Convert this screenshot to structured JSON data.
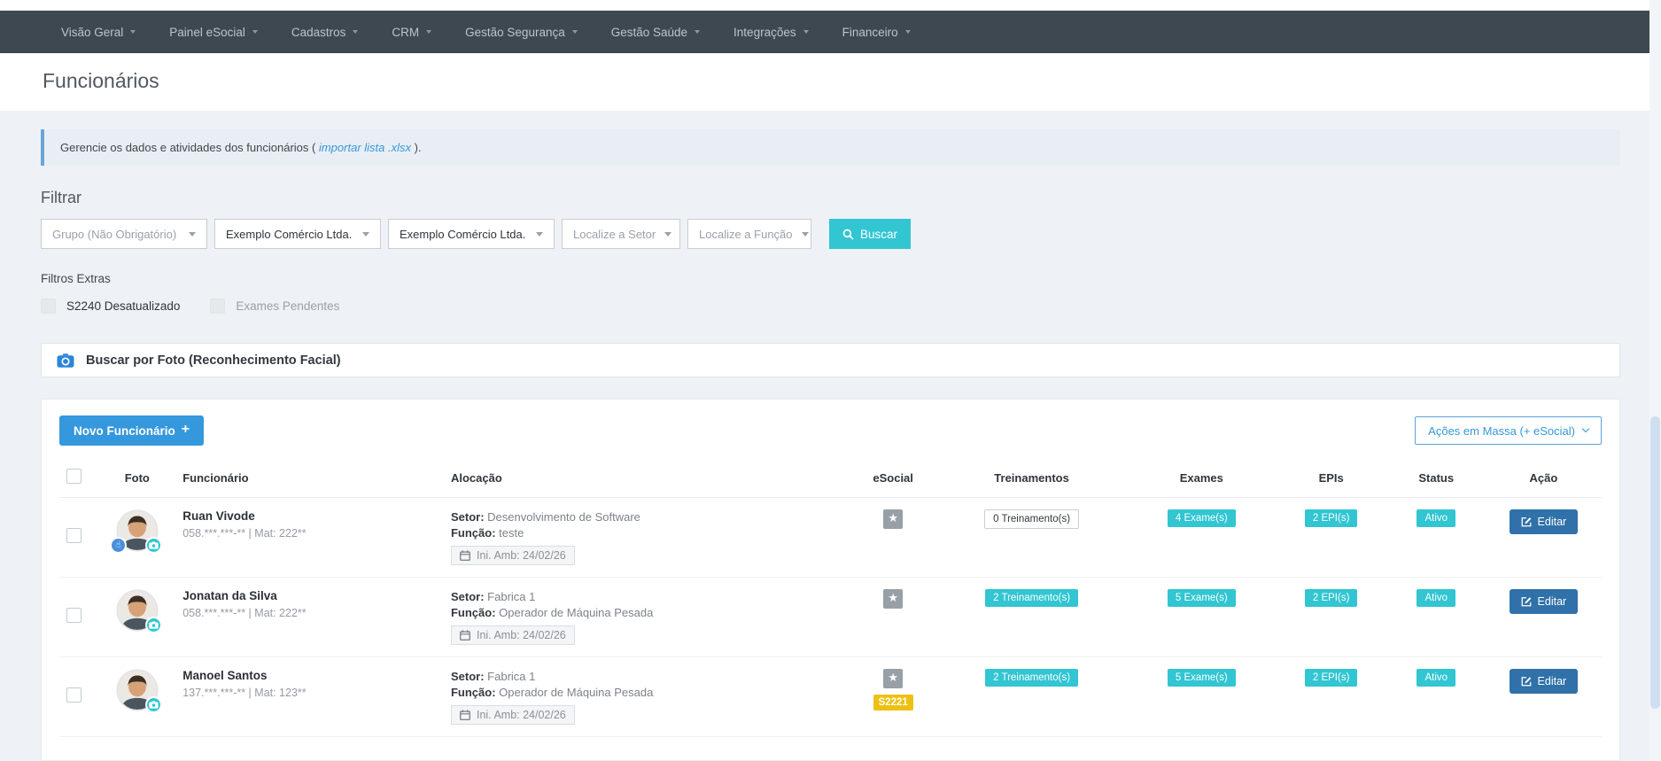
{
  "nav": {
    "items": [
      {
        "label": "Visão Geral"
      },
      {
        "label": "Painel eSocial"
      },
      {
        "label": "Cadastros"
      },
      {
        "label": "CRM"
      },
      {
        "label": "Gestão Segurança"
      },
      {
        "label": "Gestão Saúde"
      },
      {
        "label": "Integrações"
      },
      {
        "label": "Financeiro"
      }
    ]
  },
  "page": {
    "title": "Funcionários"
  },
  "banner": {
    "text_before": "Gerencie os dados e atividades dos funcionários (",
    "link_text": "importar lista .xlsx",
    "text_after": ")."
  },
  "filters": {
    "title": "Filtrar",
    "dropdowns": [
      {
        "label": "Grupo (Não Obrigatório)"
      },
      {
        "label": "Exemplo Comércio Ltda."
      },
      {
        "label": "Exemplo Comércio Ltda."
      },
      {
        "label": "Localize a Setor"
      },
      {
        "label": "Localize a Função"
      }
    ],
    "search_label": "Buscar",
    "extras_title": "Filtros Extras",
    "extras": [
      {
        "label": "S2240 Desatualizado"
      },
      {
        "label": "Exames Pendentes"
      }
    ]
  },
  "photo_search": {
    "label": "Buscar por Foto (Reconhecimento Facial)"
  },
  "toolbar": {
    "new_label": "Novo Funcionário",
    "bulk_label": "Ações em Massa (+ eSocial)"
  },
  "table": {
    "columns": [
      "Foto",
      "Funcionário",
      "Alocação",
      "eSocial",
      "Treinamentos",
      "Exames",
      "EPIs",
      "Status",
      "Ação"
    ],
    "labels": {
      "setor": "Setor:",
      "funcao": "Função:"
    },
    "edit_label": "Editar",
    "rows": [
      {
        "name": "Ruan Vivode",
        "meta": "058.***.***-** | Mat: 222**",
        "setor": "Desenvolvimento de Software",
        "funcao": "teste",
        "ini_amb": "Ini. Amb: 24/02/26",
        "treinamentos": "0 Treinamento(s)",
        "exames": "4 Exame(s)",
        "epis": "2 EPI(s)",
        "status": "Ativo"
      },
      {
        "name": "Jonatan da Silva",
        "meta": "058.***.***-** | Mat: 222**",
        "setor": "Fabrica 1",
        "funcao": "Operador de Máquina Pesada",
        "ini_amb": "Ini. Amb: 24/02/26",
        "treinamentos": "2 Treinamento(s)",
        "exames": "5 Exame(s)",
        "epis": "2 EPI(s)",
        "status": "Ativo"
      },
      {
        "name": "Manoel Santos",
        "meta": "137.***.***-** | Mat: 123**",
        "setor": "Fabrica 1",
        "funcao": "Operador de Máquina Pesada",
        "ini_amb": "Ini. Amb: 24/02/26",
        "esocial_tag": "S2221",
        "treinamentos": "2 Treinamento(s)",
        "exames": "5 Exame(s)",
        "epis": "2 EPI(s)",
        "status": "Ativo"
      }
    ]
  },
  "icons": {
    "star": "★",
    "plus": "+",
    "hand": "☝"
  },
  "colors": {
    "teal": "#32c5d2",
    "blue": "#3598dc",
    "edit_blue": "#3071a9",
    "yellow": "#eec111",
    "nav_bg": "#3e4851"
  }
}
